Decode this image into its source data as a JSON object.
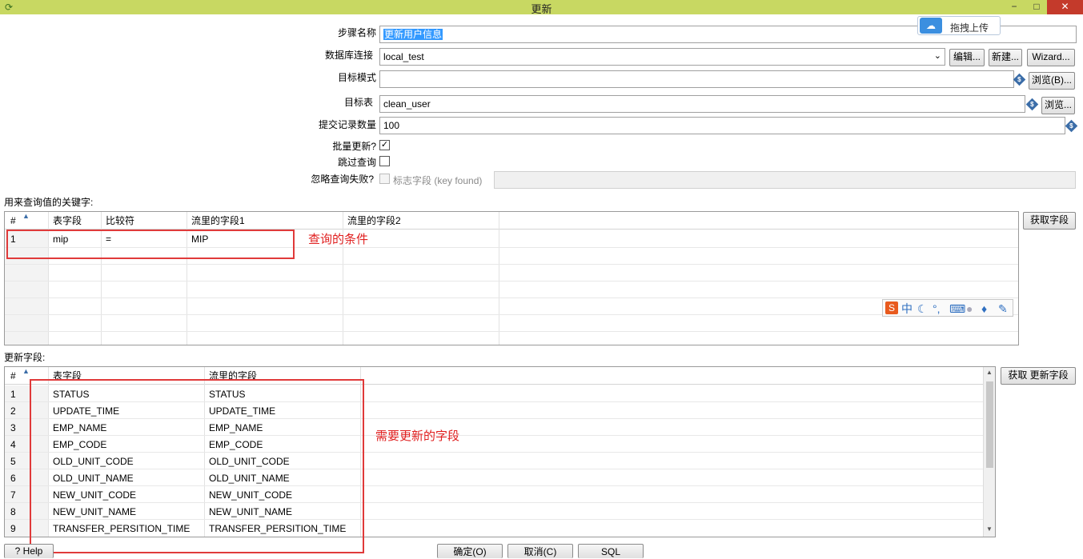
{
  "window": {
    "title": "更新",
    "minimize": "−",
    "maximize": "□",
    "close": "✕"
  },
  "cloud_upload": {
    "label": "拖拽上传"
  },
  "form": {
    "step_name_label": "步骤名称",
    "step_name_value": "更新用户信息",
    "db_conn_label": "数据库连接",
    "db_conn_value": "local_test",
    "edit_button": "编辑...",
    "new_button": "新建...",
    "wizard_button": "Wizard...",
    "target_schema_label": "目标模式",
    "target_schema_value": "",
    "browse_b_button": "浏览(B)...",
    "target_table_label": "目标表",
    "target_table_value": "clean_user",
    "browse_button": "浏览...",
    "commit_size_label": "提交记录数量",
    "commit_size_value": "100",
    "batch_update_label": "批量更新?",
    "batch_update_checked": true,
    "skip_lookup_label": "跳过查询",
    "skip_lookup_checked": false,
    "ignore_lookup_fail_label": "忽略查询失败?",
    "flag_field_label": "标志字段 (key found)",
    "flag_field_value": ""
  },
  "keys_section": {
    "label": "用来查询值的关键字:",
    "get_fields_button": "获取字段",
    "columns": [
      "#",
      "表字段",
      "比较符",
      "流里的字段1",
      "流里的字段2"
    ],
    "rows": [
      {
        "num": "1",
        "table_field": "mip",
        "comparator": "=",
        "stream_field1": "MIP",
        "stream_field2": ""
      }
    ],
    "annotation": "查询的条件"
  },
  "ime_toolbar": {
    "items": [
      "sogou-icon",
      "chinese-mode-icon",
      "moon-icon",
      "punctuation-icon",
      "keyboard-icon",
      "user-icon",
      "skin-icon",
      "wrench-icon"
    ],
    "chinese_label": "中"
  },
  "update_section": {
    "label": "更新字段:",
    "get_update_fields_button": "获取 更新字段",
    "columns": [
      "#",
      "表字段",
      "流里的字段"
    ],
    "rows": [
      {
        "num": "1",
        "table_field": "STATUS",
        "stream_field": "STATUS"
      },
      {
        "num": "2",
        "table_field": "UPDATE_TIME",
        "stream_field": "UPDATE_TIME"
      },
      {
        "num": "3",
        "table_field": "EMP_NAME",
        "stream_field": "EMP_NAME"
      },
      {
        "num": "4",
        "table_field": "EMP_CODE",
        "stream_field": "EMP_CODE"
      },
      {
        "num": "5",
        "table_field": "OLD_UNIT_CODE",
        "stream_field": "OLD_UNIT_CODE"
      },
      {
        "num": "6",
        "table_field": "OLD_UNIT_NAME",
        "stream_field": "OLD_UNIT_NAME"
      },
      {
        "num": "7",
        "table_field": "NEW_UNIT_CODE",
        "stream_field": "NEW_UNIT_CODE"
      },
      {
        "num": "8",
        "table_field": "NEW_UNIT_NAME",
        "stream_field": "NEW_UNIT_NAME"
      },
      {
        "num": "9",
        "table_field": "TRANSFER_PERSITION_TIME",
        "stream_field": "TRANSFER_PERSITION_TIME"
      }
    ],
    "annotation": "需要更新的字段"
  },
  "footer": {
    "help_button": "Help",
    "ok_button": "确定(O)",
    "cancel_button": "取消(C)",
    "sql_button": "SQL"
  }
}
